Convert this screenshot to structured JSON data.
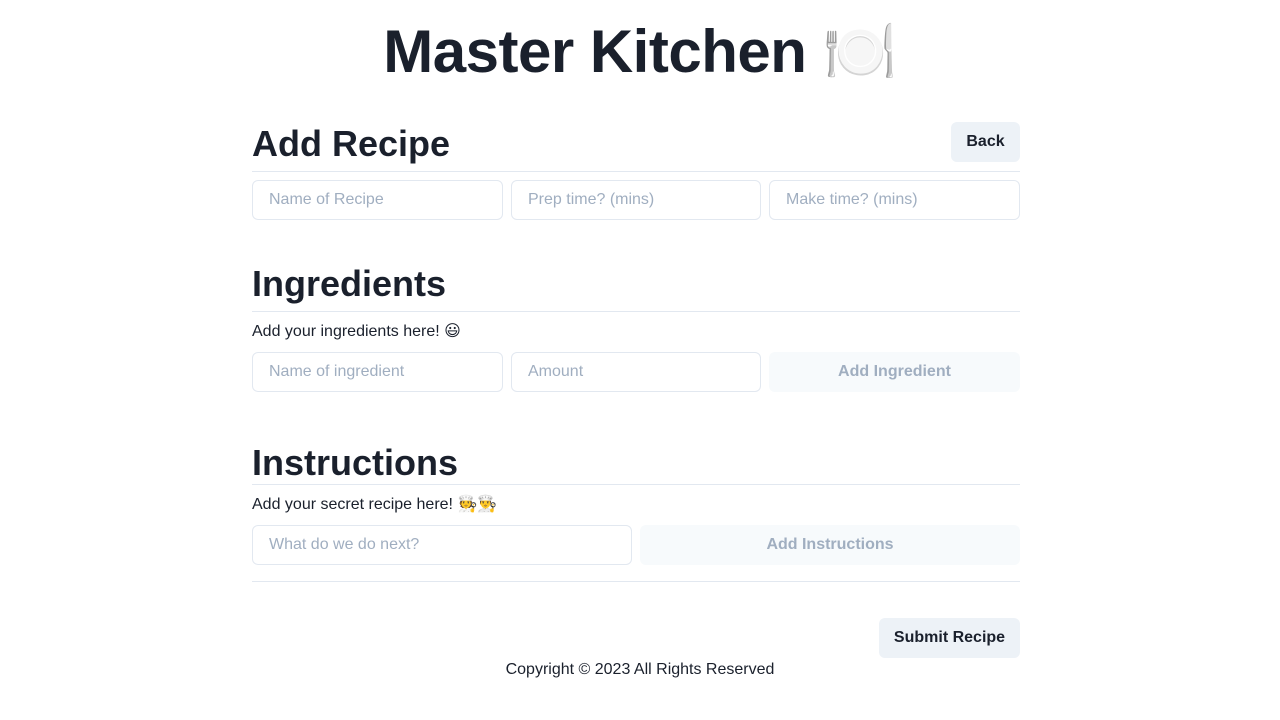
{
  "header": {
    "title": "Master Kitchen 🍽️"
  },
  "add_recipe": {
    "heading": "Add Recipe",
    "back_label": "Back",
    "name_placeholder": "Name of Recipe",
    "prep_placeholder": "Prep time? (mins)",
    "make_placeholder": "Make time? (mins)"
  },
  "ingredients": {
    "heading": "Ingredients",
    "helper": "Add your ingredients here! 😃",
    "name_placeholder": "Name of ingredient",
    "amount_placeholder": "Amount",
    "add_label": "Add Ingredient"
  },
  "instructions": {
    "heading": "Instructions",
    "helper": "Add your secret recipe here! 🧑‍🍳👨‍🍳",
    "step_placeholder": "What do we do next?",
    "add_label": "Add Instructions"
  },
  "actions": {
    "submit_label": "Submit Recipe"
  },
  "footer": {
    "copyright": "Copyright © 2023 All Rights Reserved"
  }
}
